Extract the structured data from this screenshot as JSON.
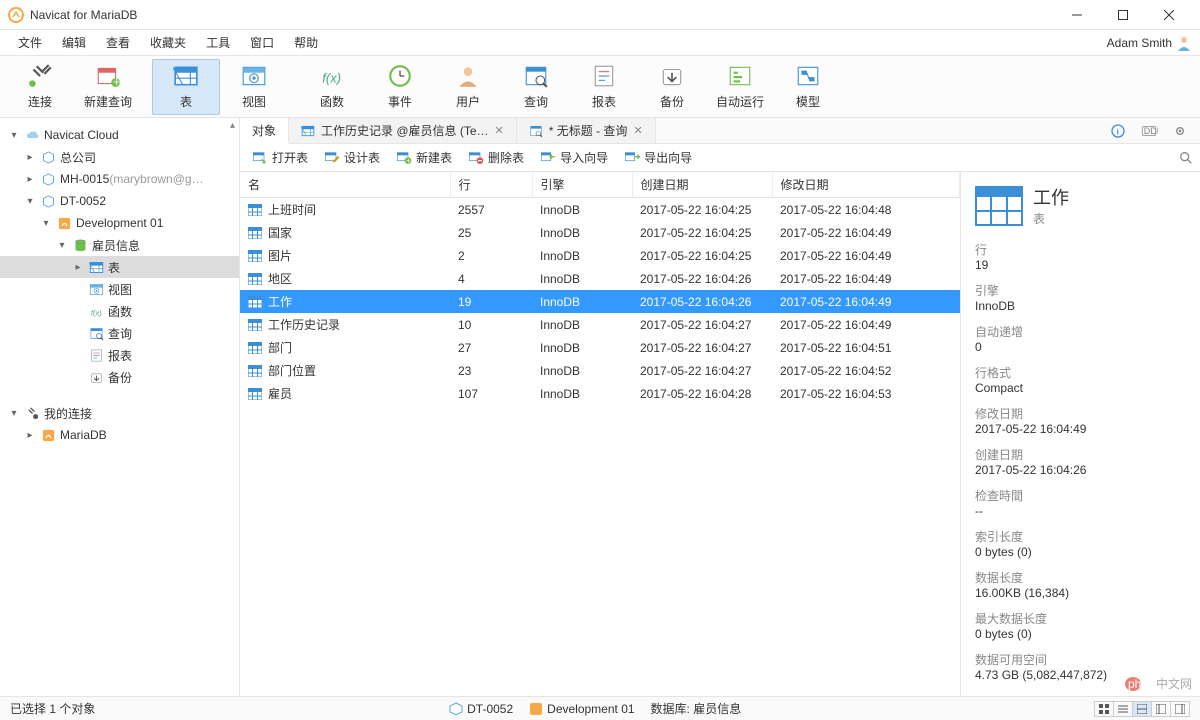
{
  "window": {
    "title": "Navicat for MariaDB"
  },
  "menu": {
    "items": [
      "文件",
      "编辑",
      "查看",
      "收藏夹",
      "工具",
      "窗口",
      "帮助"
    ],
    "user": "Adam Smith"
  },
  "toolbar": [
    {
      "label": "连接",
      "icon": "plug"
    },
    {
      "label": "新建查询",
      "icon": "new-query"
    },
    {
      "label": "表",
      "icon": "table",
      "active": true
    },
    {
      "label": "视图",
      "icon": "view"
    },
    {
      "label": "函数",
      "icon": "fx"
    },
    {
      "label": "事件",
      "icon": "clock"
    },
    {
      "label": "用户",
      "icon": "user"
    },
    {
      "label": "查询",
      "icon": "query"
    },
    {
      "label": "报表",
      "icon": "report"
    },
    {
      "label": "备份",
      "icon": "backup"
    },
    {
      "label": "自动运行",
      "icon": "auto"
    },
    {
      "label": "模型",
      "icon": "model"
    }
  ],
  "tree": [
    {
      "indent": 0,
      "exp": "▾",
      "icon": "cloud",
      "label": "Navicat Cloud"
    },
    {
      "indent": 1,
      "exp": "▸",
      "icon": "hex",
      "label": "总公司"
    },
    {
      "indent": 1,
      "exp": "▸",
      "icon": "hex",
      "label": "MH-0015",
      "suffix": "(marybrown@g…",
      "dim": true
    },
    {
      "indent": 1,
      "exp": "▾",
      "icon": "hex",
      "label": "DT-0052"
    },
    {
      "indent": 2,
      "exp": "▾",
      "icon": "conn",
      "label": "Development 01"
    },
    {
      "indent": 3,
      "exp": "▾",
      "icon": "db",
      "label": "雇员信息"
    },
    {
      "indent": 4,
      "exp": "▸",
      "icon": "table",
      "label": "表",
      "selected": true
    },
    {
      "indent": 4,
      "exp": " ",
      "icon": "view",
      "label": "视图"
    },
    {
      "indent": 4,
      "exp": " ",
      "icon": "fx",
      "label": "函数"
    },
    {
      "indent": 4,
      "exp": " ",
      "icon": "query",
      "label": "查询"
    },
    {
      "indent": 4,
      "exp": " ",
      "icon": "report",
      "label": "报表"
    },
    {
      "indent": 4,
      "exp": " ",
      "icon": "backup",
      "label": "备份"
    },
    {
      "indent": 0,
      "exp": "▾",
      "icon": "local",
      "label": "我的连接",
      "mt": true
    },
    {
      "indent": 1,
      "exp": "▸",
      "icon": "conn",
      "label": "MariaDB"
    }
  ],
  "tabs": [
    {
      "label": "对象",
      "active": true
    },
    {
      "icon": "table",
      "label": "工作历史记录 @雇员信息 (Te…",
      "close": true
    },
    {
      "icon": "query",
      "label": "* 无标题 - 查询",
      "close": true
    }
  ],
  "subtoolbar": [
    {
      "icon": "open",
      "label": "打开表"
    },
    {
      "icon": "design",
      "label": "设计表"
    },
    {
      "icon": "new",
      "label": "新建表"
    },
    {
      "icon": "delete",
      "label": "删除表"
    },
    {
      "icon": "import",
      "label": "导入向导"
    },
    {
      "icon": "export",
      "label": "导出向导"
    }
  ],
  "table": {
    "columns": [
      "名",
      "行",
      "引擎",
      "创建日期",
      "修改日期"
    ],
    "rows": [
      {
        "name": "上班时间",
        "rows": "2557",
        "engine": "InnoDB",
        "created": "2017-05-22 16:04:25",
        "modified": "2017-05-22 16:04:48"
      },
      {
        "name": "国家",
        "rows": "25",
        "engine": "InnoDB",
        "created": "2017-05-22 16:04:25",
        "modified": "2017-05-22 16:04:49"
      },
      {
        "name": "图片",
        "rows": "2",
        "engine": "InnoDB",
        "created": "2017-05-22 16:04:25",
        "modified": "2017-05-22 16:04:49"
      },
      {
        "name": "地区",
        "rows": "4",
        "engine": "InnoDB",
        "created": "2017-05-22 16:04:26",
        "modified": "2017-05-22 16:04:49"
      },
      {
        "name": "工作",
        "rows": "19",
        "engine": "InnoDB",
        "created": "2017-05-22 16:04:26",
        "modified": "2017-05-22 16:04:49",
        "selected": true
      },
      {
        "name": "工作历史记录",
        "rows": "10",
        "engine": "InnoDB",
        "created": "2017-05-22 16:04:27",
        "modified": "2017-05-22 16:04:49"
      },
      {
        "name": "部门",
        "rows": "27",
        "engine": "InnoDB",
        "created": "2017-05-22 16:04:27",
        "modified": "2017-05-22 16:04:51"
      },
      {
        "name": "部门位置",
        "rows": "23",
        "engine": "InnoDB",
        "created": "2017-05-22 16:04:27",
        "modified": "2017-05-22 16:04:52"
      },
      {
        "name": "雇员",
        "rows": "107",
        "engine": "InnoDB",
        "created": "2017-05-22 16:04:28",
        "modified": "2017-05-22 16:04:53"
      }
    ]
  },
  "props": {
    "title": "工作",
    "subtitle": "表",
    "items": [
      {
        "k": "行",
        "v": "19"
      },
      {
        "k": "引擎",
        "v": "InnoDB"
      },
      {
        "k": "自动递增",
        "v": "0"
      },
      {
        "k": "行格式",
        "v": "Compact"
      },
      {
        "k": "修改日期",
        "v": "2017-05-22 16:04:49"
      },
      {
        "k": "创建日期",
        "v": "2017-05-22 16:04:26"
      },
      {
        "k": "检查時間",
        "v": "--"
      },
      {
        "k": "索引长度",
        "v": "0 bytes (0)"
      },
      {
        "k": "数据长度",
        "v": "16.00KB (16,384)"
      },
      {
        "k": "最大数据长度",
        "v": "0 bytes (0)"
      },
      {
        "k": "数据可用空间",
        "v": "4.73 GB (5,082,447,872)"
      }
    ]
  },
  "status": {
    "left": "已选择 1 个对象",
    "conn": "DT-0052",
    "dev": "Development 01",
    "db": "数据库: 雇员信息"
  },
  "watermark": "中文网"
}
